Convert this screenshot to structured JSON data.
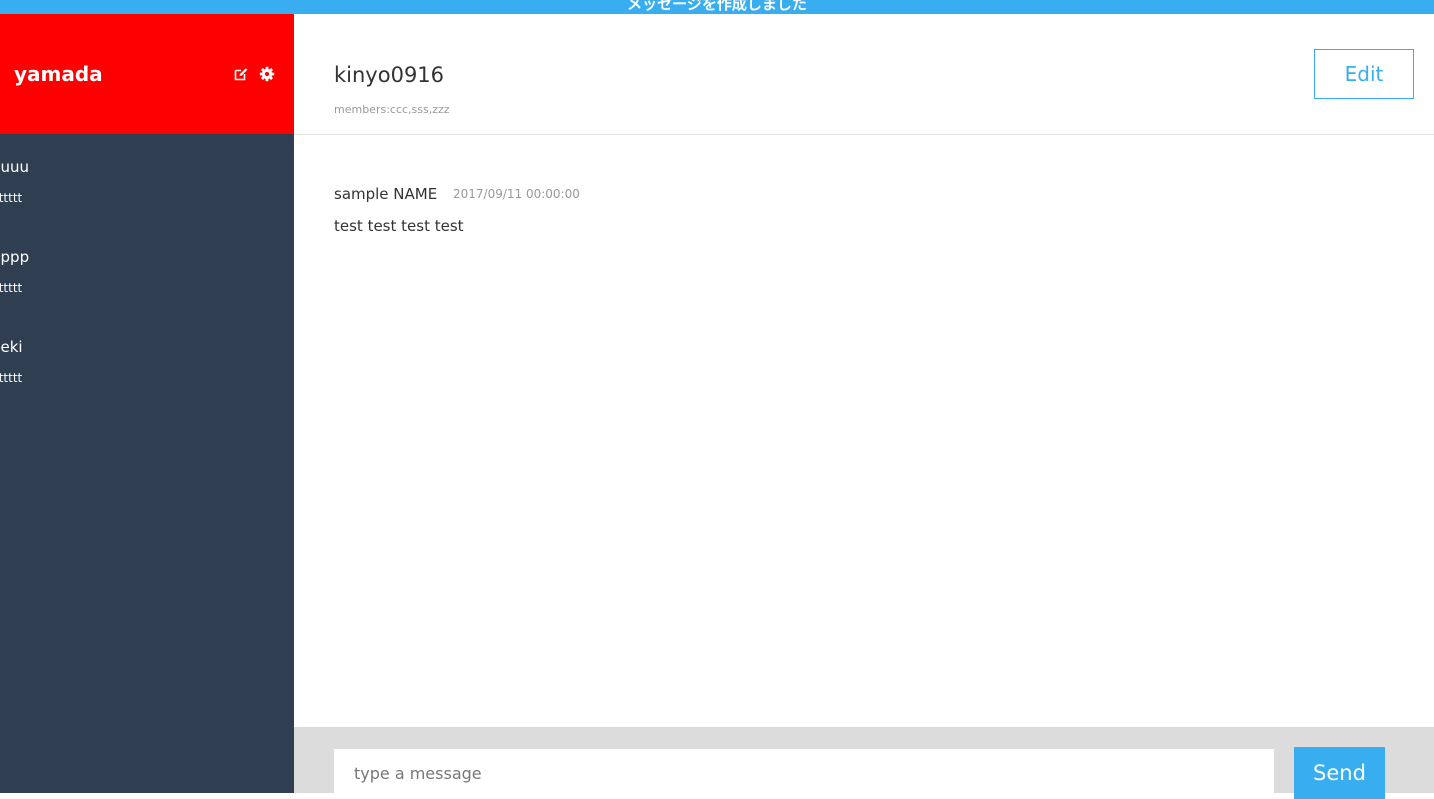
{
  "notice": {
    "text": "メッセージを作成しました",
    "color": "#38aef0"
  },
  "sidebar": {
    "user_name": "yamada",
    "header_color": "#ff0000",
    "background_color": "#2f3e50",
    "icons": [
      "edit-icon",
      "gear-icon"
    ],
    "groups": [
      {
        "name": "uuuu",
        "last_message": "tttttt"
      },
      {
        "name": "pppp",
        "last_message": "tttttt"
      },
      {
        "name": "deki",
        "last_message": "tttttt"
      }
    ]
  },
  "main": {
    "group_name": "kinyo0916",
    "members": "members:ccc,sss,zzz",
    "edit_label": "Edit",
    "messages": [
      {
        "user": "sample NAME",
        "date": "2017/09/11 00:00:00",
        "text": "test test test test"
      }
    ]
  },
  "form": {
    "placeholder": "type a message",
    "value": "",
    "send_label": "Send",
    "accent_color": "#38aef0"
  }
}
